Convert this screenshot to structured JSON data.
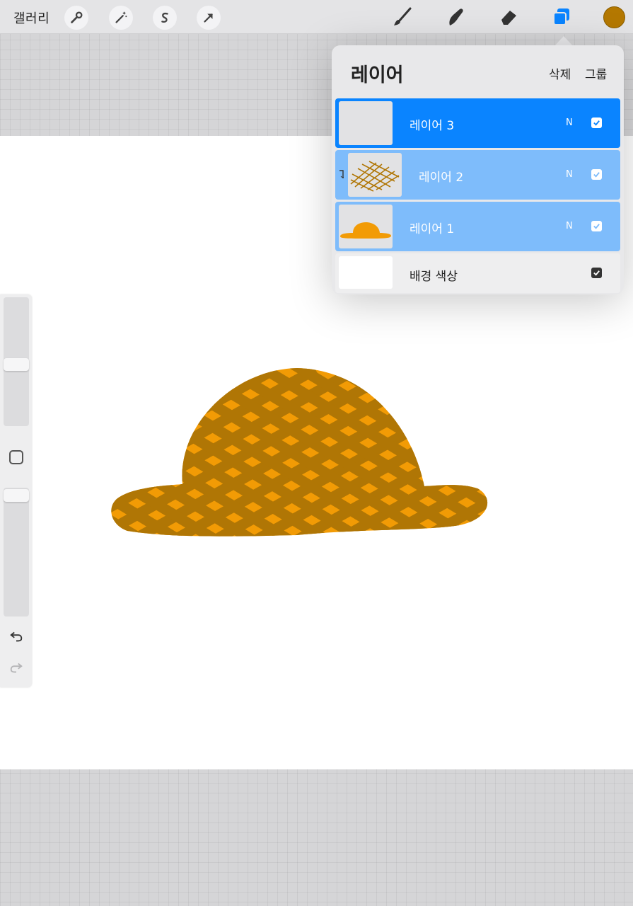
{
  "toolbar": {
    "gallery_label": "갤러리",
    "left_tools": [
      "wrench-icon",
      "magic-wand-icon",
      "selection-icon",
      "transform-arrow-icon"
    ],
    "right_tools": [
      "brush-icon",
      "smudge-icon",
      "eraser-icon",
      "layers-icon"
    ],
    "current_color": "#b47800"
  },
  "layers_panel": {
    "title": "레이어",
    "delete_label": "삭제",
    "group_label": "그룹",
    "layers": [
      {
        "name": "레이어 3",
        "blend": "N",
        "visible": true,
        "state": "active"
      },
      {
        "name": "레이어 2",
        "blend": "N",
        "visible": true,
        "state": "selected",
        "clipped": true
      },
      {
        "name": "레이어 1",
        "blend": "N",
        "visible": true,
        "state": "selected"
      }
    ],
    "background": {
      "name": "배경 색상",
      "visible": true
    }
  },
  "colors": {
    "accent": "#0a84ff",
    "selected_row": "#7ebcfb",
    "hat_fill": "#f29b05",
    "hat_stripe": "#b07605"
  }
}
